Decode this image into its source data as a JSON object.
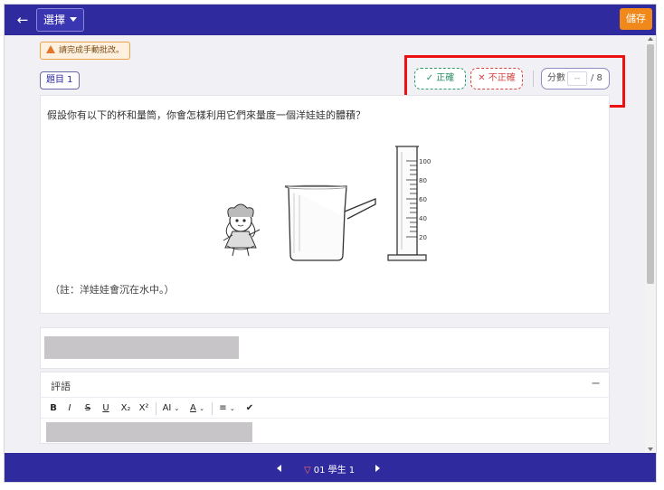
{
  "header": {
    "back_icon": "arrow-left-icon",
    "select_label": "選擇",
    "save_label": "儲存",
    "colors": {
      "bar": "#2f2a9e",
      "save": "#f0881a"
    }
  },
  "notice": {
    "text": "請完成手動批改。"
  },
  "question": {
    "number_label": "題目 1",
    "text": "假設你有以下的杯和量筒，你會怎樣利用它們來量度一個洋娃娃的體積？",
    "note": "（註：洋娃娃會沉在水中。）",
    "figure": {
      "doll_icon": "doll-image",
      "beaker_icon": "beaker-image",
      "cylinder_icon": "measuring-cylinder-image",
      "cylinder_scale": [
        "100",
        "80",
        "60",
        "40",
        "20"
      ]
    }
  },
  "grading": {
    "correct_label": "正確",
    "incorrect_label": "不正確",
    "score_label": "分數",
    "score_placeholder": "--",
    "score_max": "/ 8",
    "colors": {
      "correct": "#2a8f63",
      "incorrect": "#d84444",
      "highlight": "#e11111"
    }
  },
  "comment": {
    "title": "評語",
    "collapse": "−",
    "toolbar": {
      "bold": "B",
      "italic": "I",
      "strike": "S",
      "underline": "U",
      "subscript": "X₂",
      "superscript": "X²",
      "font_size": "AI",
      "font_color": "A",
      "align": "≡",
      "special": "✔"
    }
  },
  "footer": {
    "student_label": "01 學生 1"
  }
}
